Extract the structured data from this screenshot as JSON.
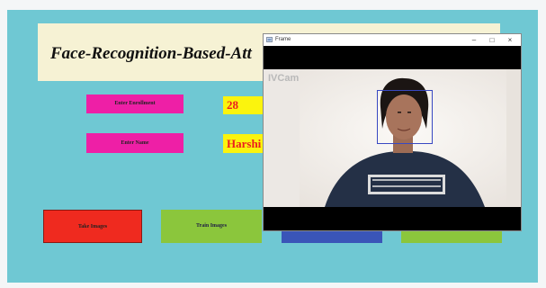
{
  "app": {
    "title": "Face-Recognition-Based-Att",
    "enrollment_label": "Enter Enrollment",
    "enrollment_value": "28",
    "name_label": "Enter Name",
    "name_value": "Harshi",
    "buttons": {
      "take_images": "Take Images",
      "train_images": "Train Images"
    },
    "colors": {
      "background": "#6fc8d3",
      "title_banner": "#f6f2d4",
      "label_pink": "#ee1fa6",
      "field_yellow": "#fbf40d",
      "field_text_red": "#ec1e1e",
      "take_images_red": "#ef2a1f",
      "train_images_green": "#8bc63c",
      "third_button_blue": "#3a55b8",
      "face_box_blue": "#3848c2"
    }
  },
  "frame_window": {
    "title": "Frame",
    "watermark": "IVCam",
    "controls": {
      "minimize": "–",
      "maximize": "□",
      "close": "×"
    }
  }
}
